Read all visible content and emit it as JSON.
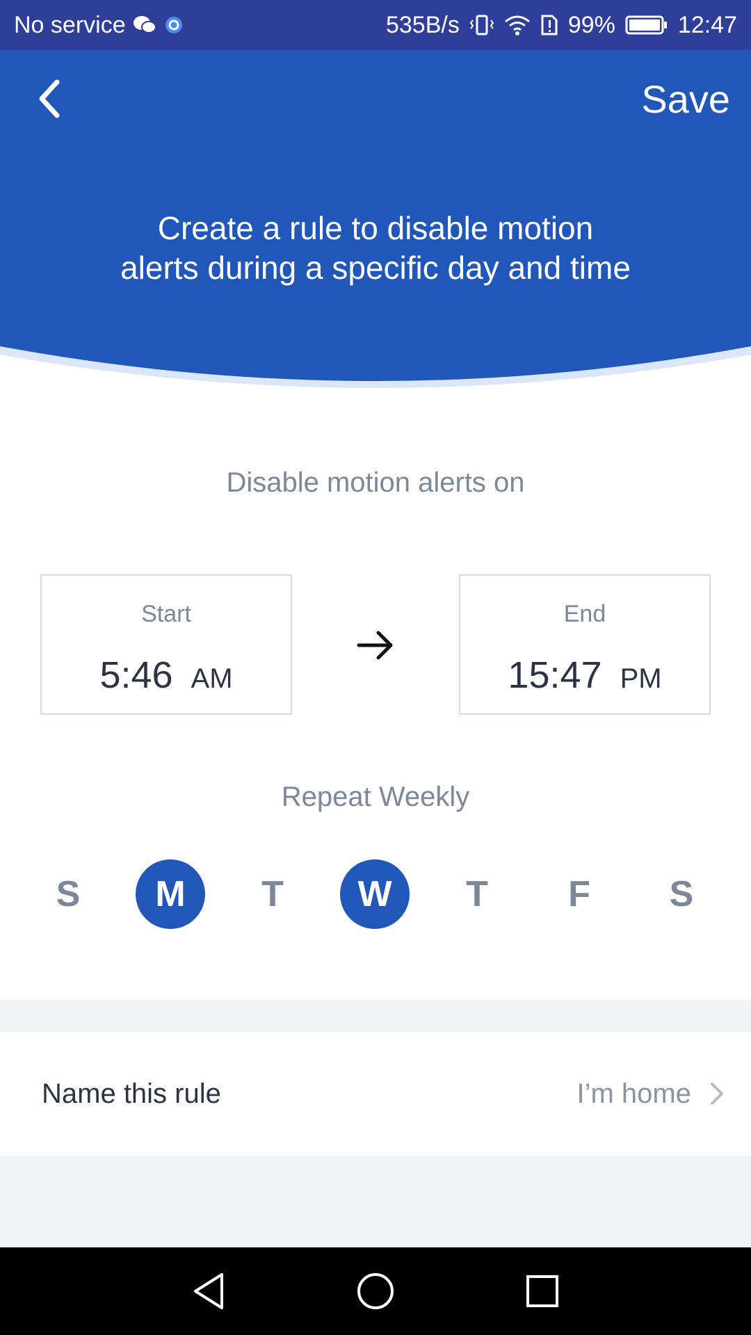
{
  "statusbar": {
    "carrier": "No service",
    "net_speed": "535B/s",
    "battery": "99%",
    "time": "12:47"
  },
  "header": {
    "save_label": "Save",
    "headline_line1": "Create a rule to disable motion",
    "headline_line2": "alerts during a specific day and time"
  },
  "main": {
    "disable_title": "Disable motion alerts on",
    "start": {
      "label": "Start",
      "time": "5:46",
      "ampm": "AM"
    },
    "end": {
      "label": "End",
      "time": "15:47",
      "ampm": "PM"
    },
    "repeat_title": "Repeat Weekly",
    "days": [
      {
        "letter": "S",
        "selected": false
      },
      {
        "letter": "M",
        "selected": true
      },
      {
        "letter": "T",
        "selected": false
      },
      {
        "letter": "W",
        "selected": true
      },
      {
        "letter": "T",
        "selected": false
      },
      {
        "letter": "F",
        "selected": false
      },
      {
        "letter": "S",
        "selected": false
      }
    ]
  },
  "rule_name": {
    "label": "Name this rule",
    "value": "I’m home"
  },
  "colors": {
    "header_blue": "#2157b8",
    "statusbar_blue": "#2f3f99",
    "muted_text": "#7d879a",
    "dark_text": "#2c3444"
  },
  "icons": {
    "back": "chevron-left-icon",
    "arrow": "arrow-right-icon",
    "rule_chevron": "chevron-right-icon",
    "nav": [
      "nav-back-icon",
      "nav-home-icon",
      "nav-recents-icon"
    ]
  }
}
